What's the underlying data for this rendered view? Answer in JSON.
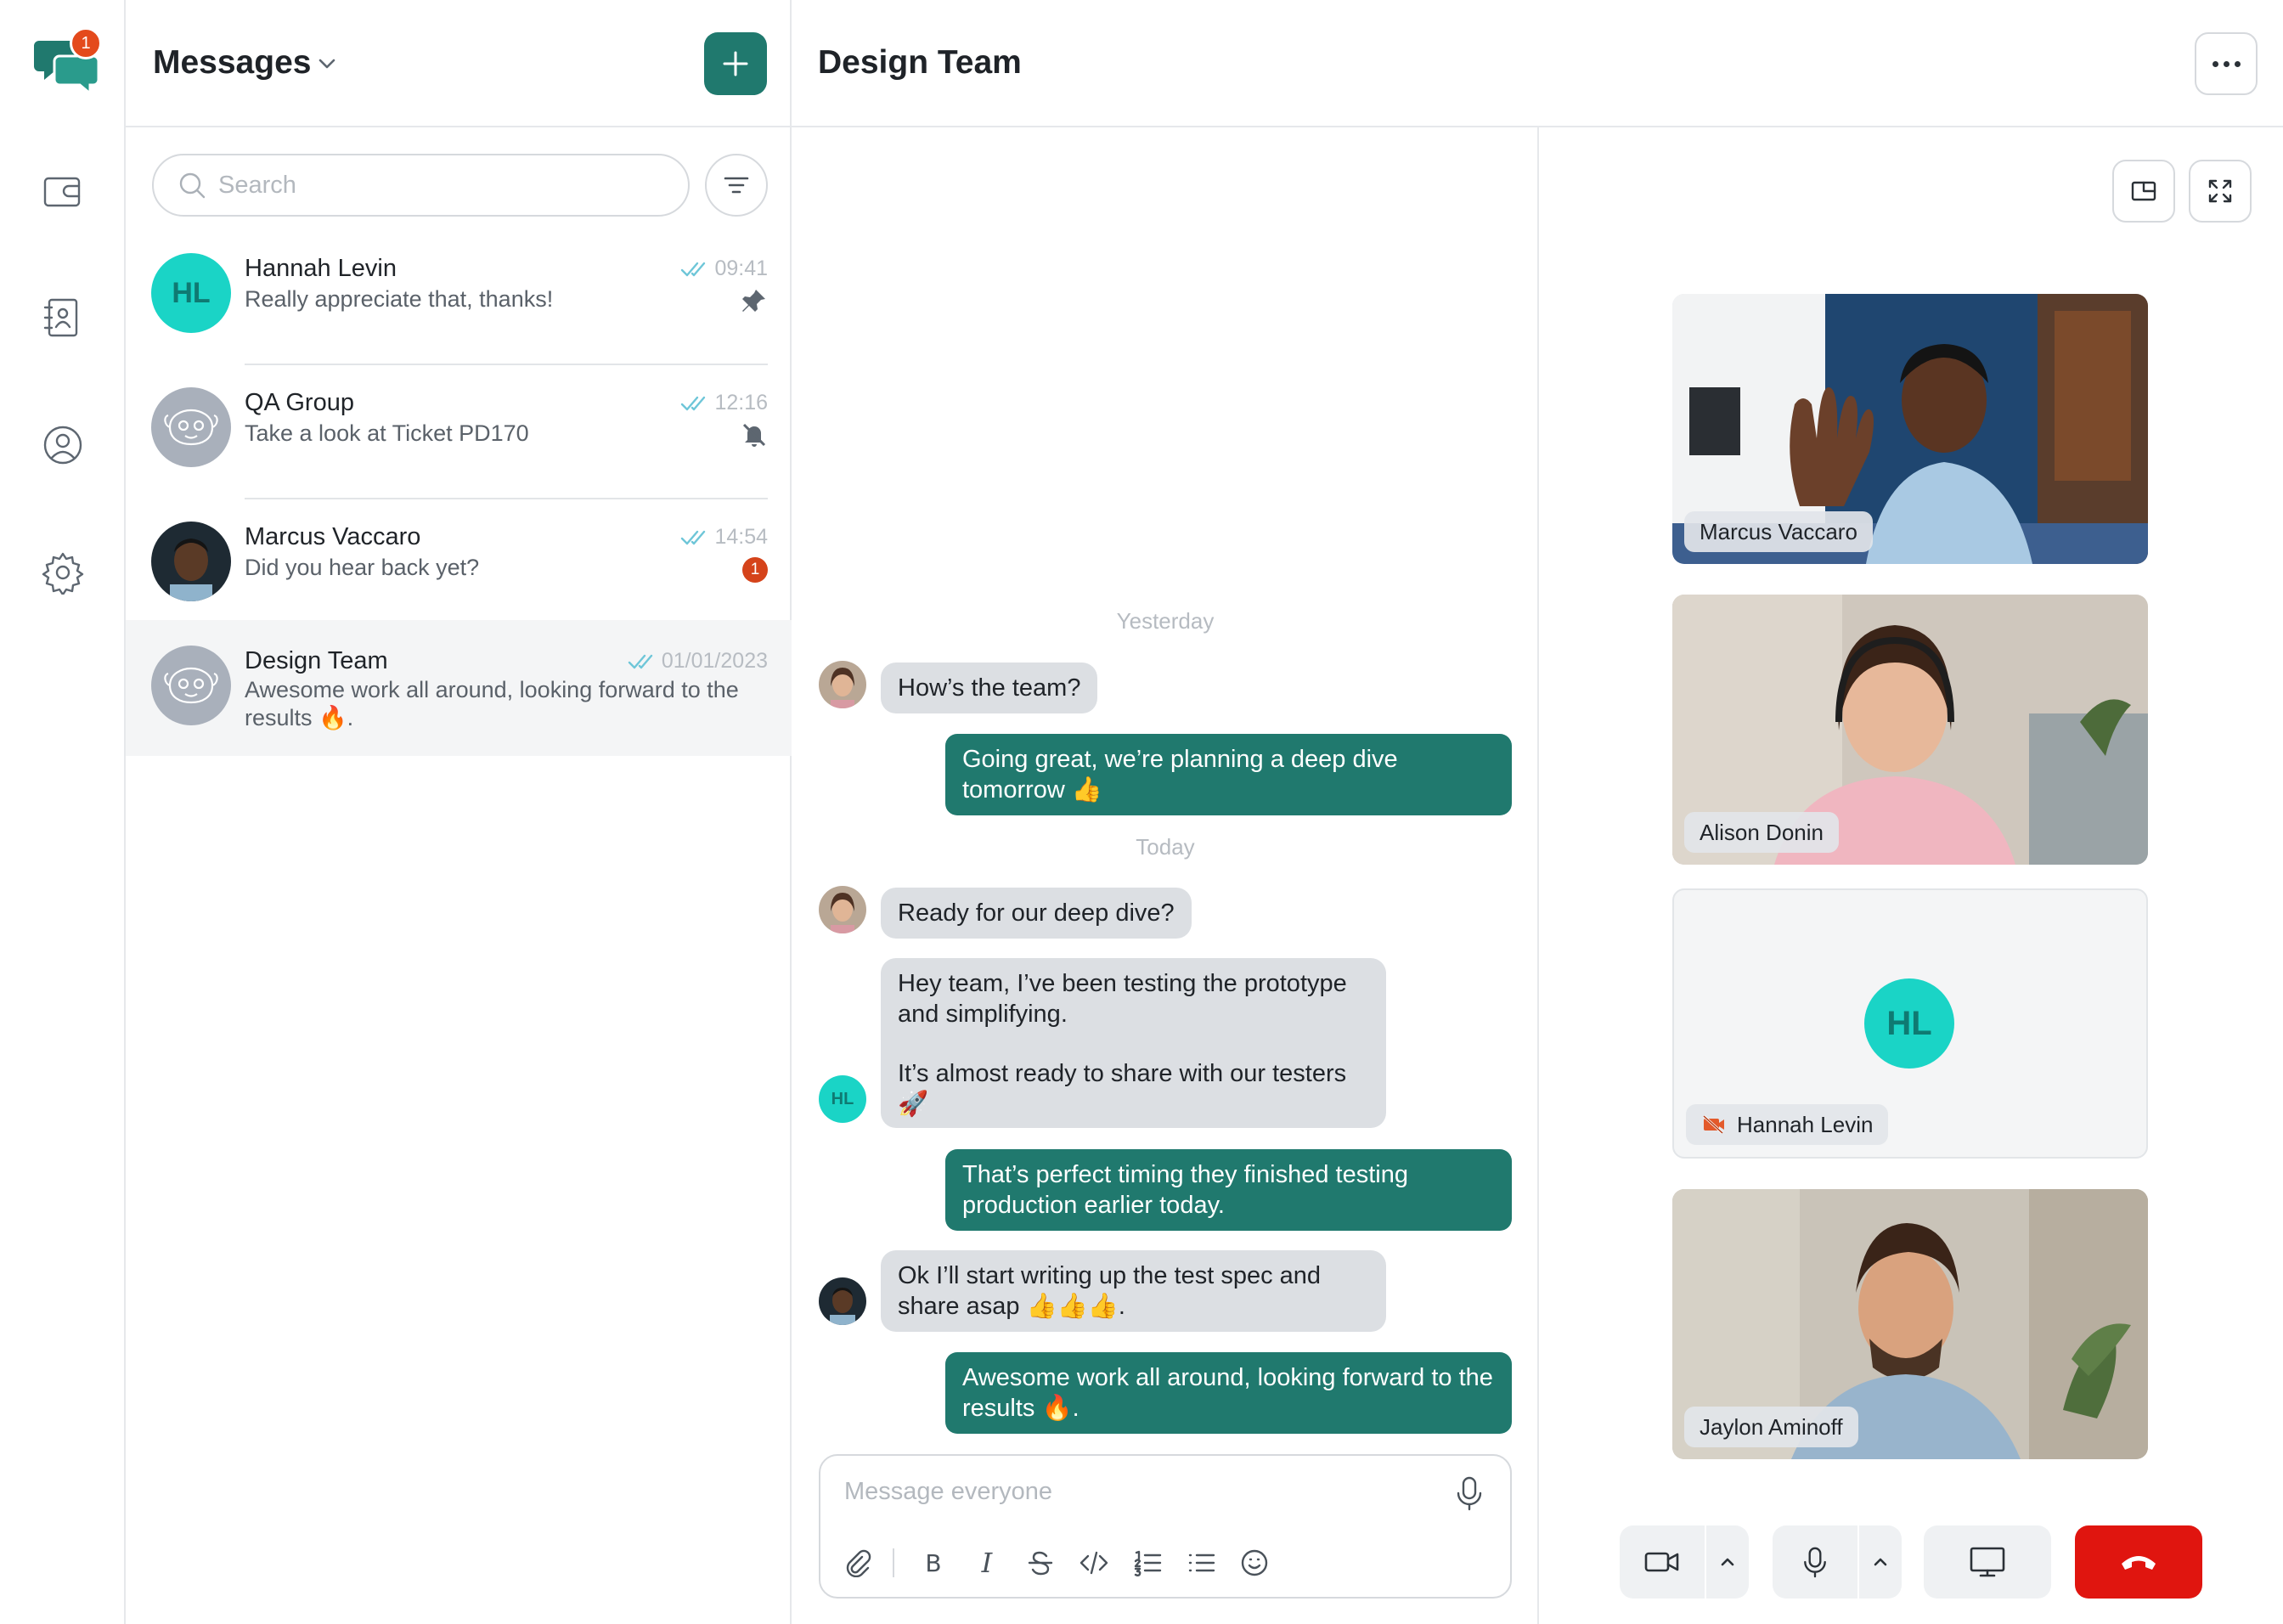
{
  "app": {
    "notification_count": "1"
  },
  "sidebar": {
    "items": [
      {
        "icon": "wallet-icon"
      },
      {
        "icon": "contacts-icon"
      },
      {
        "icon": "profile-icon"
      },
      {
        "icon": "settings-icon"
      }
    ]
  },
  "messages_panel": {
    "title": "Messages",
    "search_placeholder": "Search",
    "conversations": [
      {
        "name": "Hannah Levin",
        "initials": "HL",
        "preview": "Really appreciate that, thanks!",
        "time": "09:41",
        "status_icon": "pin-icon"
      },
      {
        "name": "QA Group",
        "preview": "Take a look at Ticket PD170",
        "time": "12:16",
        "status_icon": "bell-muted-icon"
      },
      {
        "name": "Marcus Vaccaro",
        "preview": "Did you hear back yet?",
        "time": "14:54",
        "unread": "1"
      },
      {
        "name": "Design Team",
        "preview": "Awesome work all around, looking forward to the results 🔥.",
        "time": "01/01/2023",
        "active": true
      }
    ]
  },
  "chat": {
    "title": "Design Team",
    "days": {
      "yesterday": "Yesterday",
      "today": "Today"
    },
    "messages": [
      {
        "dir": "in",
        "text": "How’s the team?"
      },
      {
        "dir": "out",
        "text": "Going great, we’re planning a deep dive tomorrow 👍"
      },
      {
        "dir": "in",
        "text": "Ready for our deep dive?"
      },
      {
        "dir": "in",
        "initials": "HL",
        "text_line1": "Hey team, I’ve been testing the prototype and simplifying.",
        "text_line2": "It’s almost ready to share with our testers 🚀"
      },
      {
        "dir": "out",
        "text": "That’s perfect timing they finished testing production earlier today."
      },
      {
        "dir": "in",
        "text": "Ok I’ll start writing up the test spec and share asap 👍👍👍."
      },
      {
        "dir": "out",
        "text": "Awesome work all around, looking forward to the results 🔥."
      }
    ],
    "composer_placeholder": "Message everyone",
    "toolbar": {
      "bold": "B",
      "italic": "I"
    }
  },
  "call": {
    "participants": [
      {
        "name": "Marcus Vaccaro"
      },
      {
        "name": "Alison Donin"
      },
      {
        "name": "Hannah Levin",
        "initials": "HL",
        "video_off": true
      },
      {
        "name": "Jaylon Aminoff"
      }
    ]
  },
  "colors": {
    "accent": "#20796e",
    "avatar_teal": "#1ad4c6",
    "badge": "#e44a1c",
    "hangup": "#e0150f"
  }
}
